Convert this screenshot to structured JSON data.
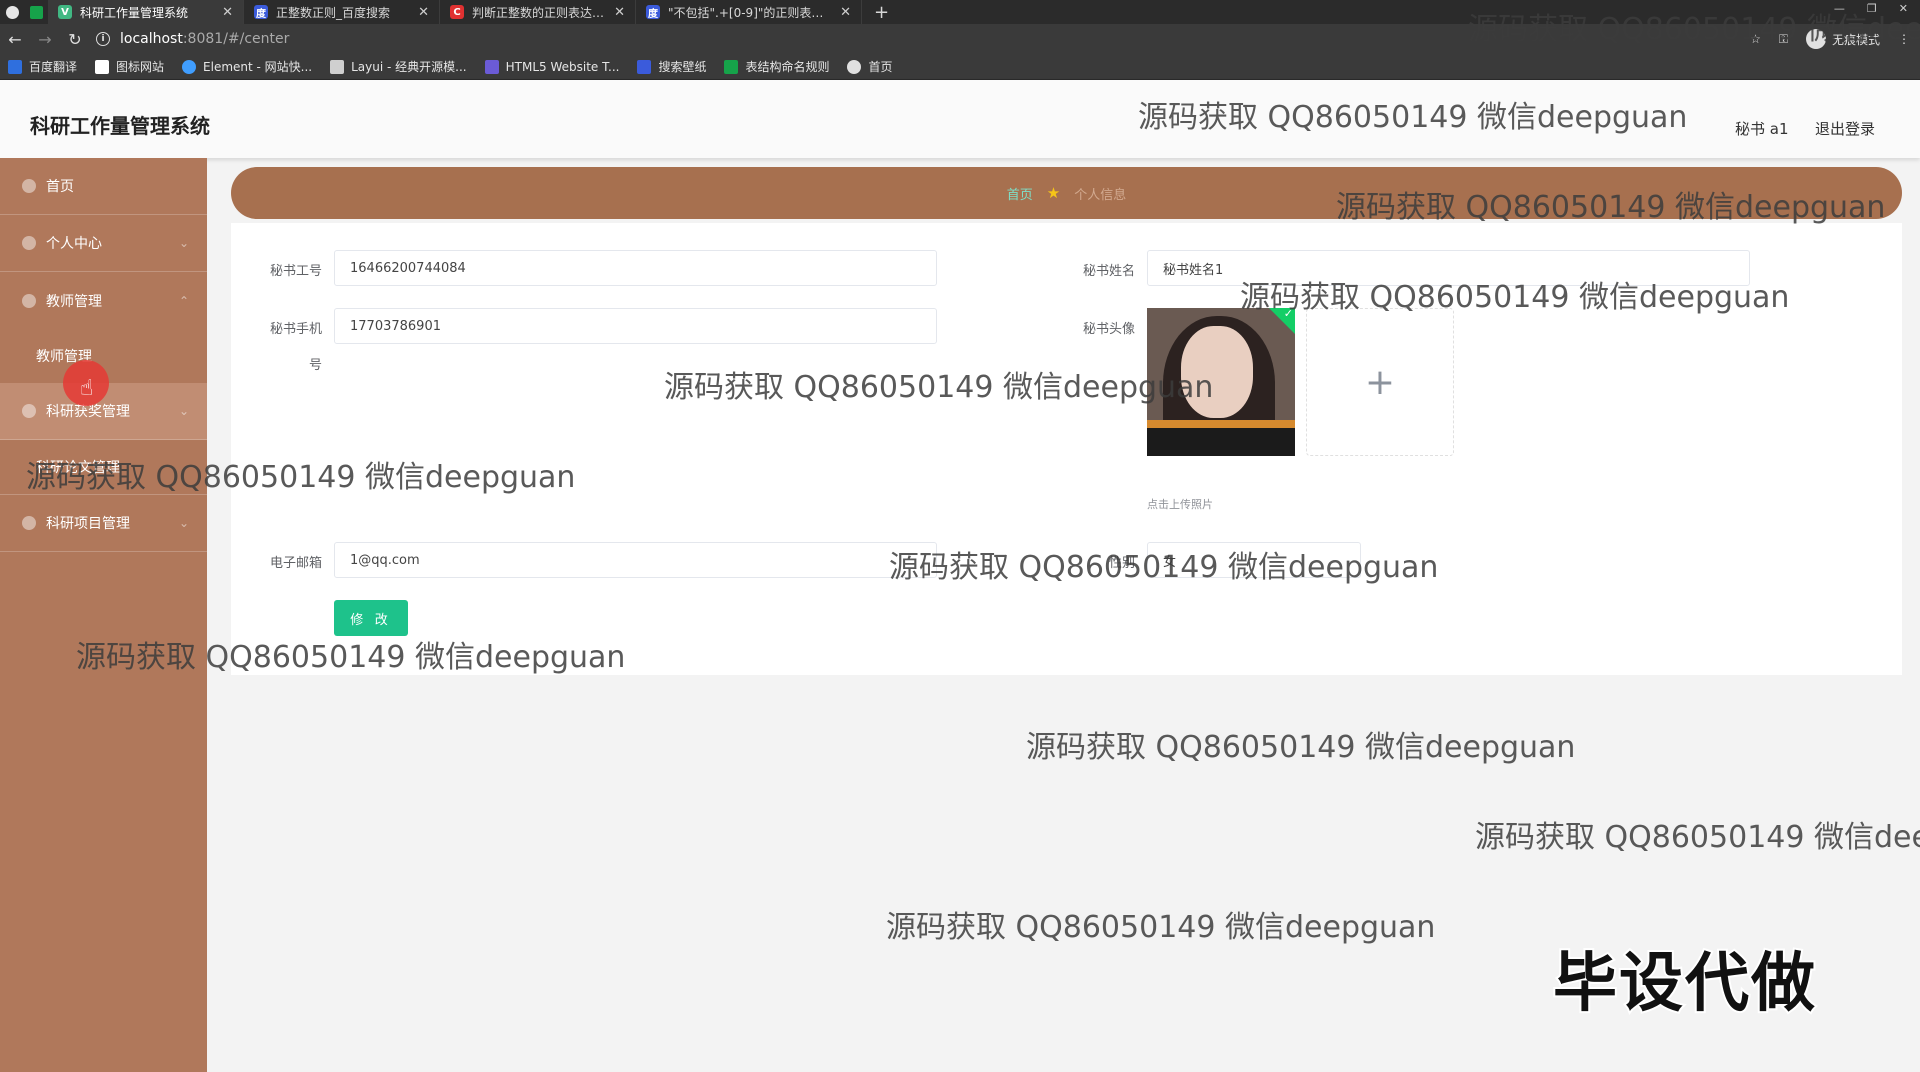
{
  "browser": {
    "tabs": [
      {
        "title": "科研工作量管理系统",
        "active": true,
        "favicon_color": "#41b883",
        "icon": "vue-logo-icon"
      },
      {
        "title": "正整数正则_百度搜索",
        "active": false,
        "favicon_color": "#3b5bdb",
        "icon": "baidu-paw-icon"
      },
      {
        "title": "判断正整数的正则表达式_小哥`",
        "active": false,
        "favicon_color": "#e03131",
        "icon": "csdn-icon"
      },
      {
        "title": "\"不包括\".+[0-9]\"的正则表达式_",
        "active": false,
        "favicon_color": "#3b5bdb",
        "icon": "baidu-paw-icon"
      }
    ],
    "url_host": "localhost",
    "url_rest": ":8081/#/center",
    "incognito_label": "无痕模式",
    "bookmarks": [
      {
        "label": "百度翻译",
        "color": "#2f6fde"
      },
      {
        "label": "图标网站",
        "color": "#ffffff"
      },
      {
        "label": "Element - 网站快...",
        "color": "#409eff"
      },
      {
        "label": "Layui - 经典开源模...",
        "color": "#cfcfcf"
      },
      {
        "label": "HTML5 Website T...",
        "color": "#6b5bd6"
      },
      {
        "label": "搜索壁纸",
        "color": "#3b5bdb"
      },
      {
        "label": "表结构命名规则",
        "color": "#16a34a"
      },
      {
        "label": "首页",
        "color": "#e0e0e0"
      }
    ]
  },
  "app": {
    "title": "科研工作量管理系统",
    "user": "秘书 a1",
    "logout": "退出登录"
  },
  "sidebar": {
    "items": [
      {
        "label": "首页",
        "icon": "home-icon"
      },
      {
        "label": "个人中心",
        "icon": "user-icon"
      },
      {
        "label": "教师管理",
        "icon": "teacher-icon"
      },
      {
        "label": "教师管理",
        "icon": ""
      },
      {
        "label": "科研获奖管理",
        "icon": "award-icon"
      },
      {
        "label": "科研论文管理",
        "icon": ""
      },
      {
        "label": "科研项目管理",
        "icon": "project-icon"
      }
    ]
  },
  "breadcrumb": {
    "home": "首页",
    "current": "个人信息"
  },
  "form": {
    "id_label": "秘书工号",
    "id_value": "16466200744084",
    "name_label": "秘书姓名",
    "name_value": "秘书姓名1",
    "phone_label": "秘书手机",
    "phone_label2": "号",
    "phone_value": "17703786901",
    "avatar_label": "秘书头像",
    "upload_tip": "点击上传照片",
    "email_label": "电子邮箱",
    "email_value": "1@qq.com",
    "gender_label": "性别",
    "gender_value": "女",
    "submit": "修 改"
  },
  "overlay": {
    "watermark": "源码获取 QQ86050149 微信deepguan",
    "stamp": "毕设代做"
  }
}
